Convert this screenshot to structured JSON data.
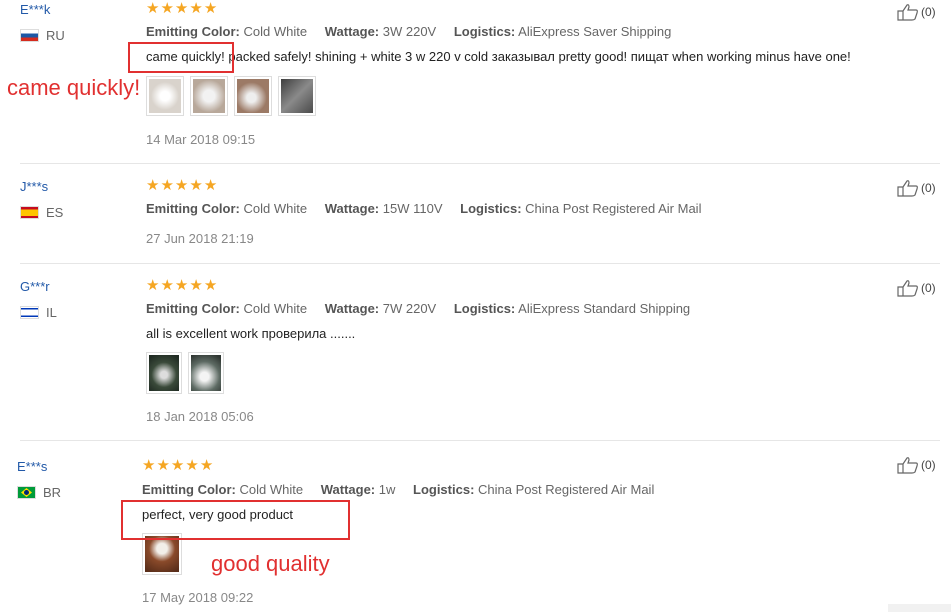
{
  "labels": {
    "color_key": "Emitting Color:",
    "watt_key": "Wattage:",
    "log_key": "Logistics:"
  },
  "reviews": [
    {
      "user": "E***k",
      "country": "RU",
      "flag_colors": [
        "#ffffff",
        "#1c57a5",
        "#d52b1e"
      ],
      "rating": 5,
      "color": "Cold White",
      "wattage": "3W 220V",
      "logistics": "AliExpress Saver Shipping",
      "text": "came quickly! packed safely! shining + white 3 w 220 v cold заказывал pretty good! пищат when working minus have one!",
      "photos": [
        "#d9d3cc",
        "#b8a89a",
        "#9c7a66",
        "#5b5b5b"
      ],
      "date": "14 Mar 2018 09:15",
      "likes": "(0)"
    },
    {
      "user": "J***s",
      "country": "ES",
      "flag_colors": [
        "#c60b1e",
        "#ffc400",
        "#c60b1e"
      ],
      "rating": 5,
      "color": "Cold White",
      "wattage": "15W 110V",
      "logistics": "China Post Registered Air Mail",
      "text": "",
      "photos": [],
      "date": "27 Jun 2018 21:19",
      "likes": "(0)"
    },
    {
      "user": "G***r",
      "country": "IL",
      "flag_colors": [
        "#ffffff",
        "#0038b8",
        "#ffffff"
      ],
      "rating": 5,
      "color": "Cold White",
      "wattage": "7W 220V",
      "logistics": "AliExpress Standard Shipping",
      "text": "all is excellent work проверила .......",
      "photos": [
        "#3a4a3a",
        "#5e6b64"
      ],
      "date": "18 Jan 2018 05:06",
      "likes": "(0)"
    },
    {
      "user": "E***s",
      "country": "BR",
      "flag_colors": [
        "#009b3a",
        "#fedf00",
        "#002776"
      ],
      "rating": 5,
      "color": "Cold White",
      "wattage": "1w",
      "logistics": "China Post Registered Air Mail",
      "text": "perfect, very good product",
      "photos": [
        "#8a4a2a"
      ],
      "date": "17 May 2018 09:22",
      "likes": "(0)"
    }
  ],
  "annotations": {
    "note1": "came quickly!",
    "note2": "good quality",
    "color": "#e13030"
  },
  "icons": {
    "star": "star-icon",
    "like": "thumbs-up-icon"
  }
}
